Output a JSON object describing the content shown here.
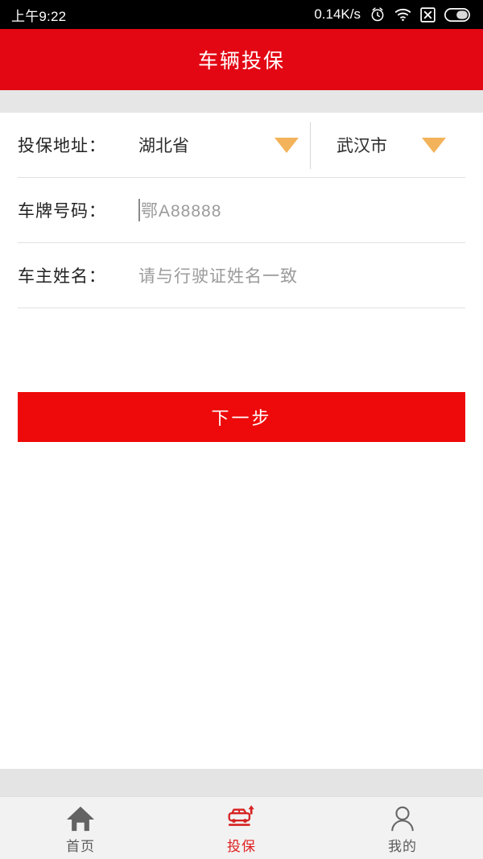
{
  "status_bar": {
    "time": "上午9:22",
    "network_speed": "0.14K/s",
    "icons": [
      "alarm-icon",
      "wifi-icon",
      "no-signal-icon",
      "battery-icon"
    ]
  },
  "header": {
    "title": "车辆投保"
  },
  "form": {
    "address_row": {
      "label": "投保地址：",
      "province_value": "湖北省",
      "city_value": "武汉市",
      "province_caret": "chevron-down-icon",
      "city_caret": "chevron-down-icon"
    },
    "plate_row": {
      "label": "车牌号码：",
      "value": "",
      "placeholder": "鄂A88888"
    },
    "owner_row": {
      "label": "车主姓名：",
      "value": "",
      "placeholder": "请与行驶证姓名一致"
    }
  },
  "actions": {
    "next_label": "下一步"
  },
  "bottom_nav": {
    "items": [
      {
        "label": "首页",
        "icon": "home-icon",
        "active": false
      },
      {
        "label": "投保",
        "icon": "car-insure-icon",
        "active": true
      },
      {
        "label": "我的",
        "icon": "person-icon",
        "active": false
      }
    ]
  },
  "colors": {
    "header_red": "#E30613",
    "button_red": "#EE0A0A",
    "caret_orange": "#F2B35A",
    "active_nav_red": "#E02020"
  }
}
